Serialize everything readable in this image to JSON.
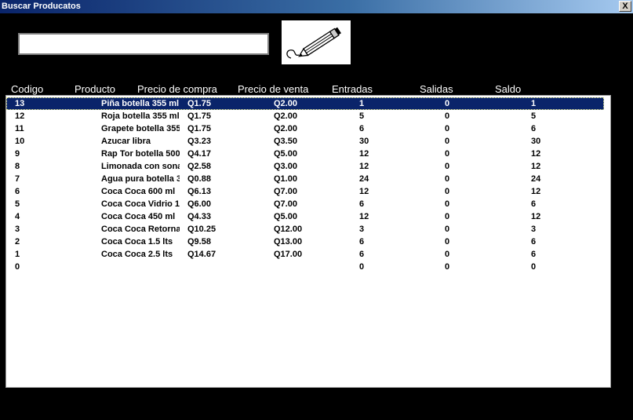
{
  "window": {
    "title": "Buscar Producatos",
    "close_label": "X"
  },
  "search": {
    "value": "",
    "placeholder": ""
  },
  "columns": [
    "Codigo",
    "Producto",
    "Precio de compra",
    "Precio de venta",
    "Entradas",
    "Salidas",
    "Saldo"
  ],
  "rows": [
    {
      "codigo": "13",
      "producto": "Piña botella 355 ml",
      "compra": "Q1.75",
      "venta": "Q2.00",
      "entradas": "1",
      "salidas": "0",
      "saldo": "1",
      "selected": true
    },
    {
      "codigo": "12",
      "producto": "Roja botella 355 ml",
      "compra": "Q1.75",
      "venta": "Q2.00",
      "entradas": "5",
      "salidas": "0",
      "saldo": "5"
    },
    {
      "codigo": "11",
      "producto": "Grapete botella 355",
      "compra": "Q1.75",
      "venta": "Q2.00",
      "entradas": "6",
      "salidas": "0",
      "saldo": "6"
    },
    {
      "codigo": "10",
      "producto": "Azucar libra",
      "compra": "Q3.23",
      "venta": "Q3.50",
      "entradas": "30",
      "salidas": "0",
      "saldo": "30"
    },
    {
      "codigo": "9",
      "producto": "Rap Tor botella 500",
      "compra": "Q4.17",
      "venta": "Q5.00",
      "entradas": "12",
      "salidas": "0",
      "saldo": "12"
    },
    {
      "codigo": "8",
      "producto": "Limonada con sona",
      "compra": "Q2.58",
      "venta": "Q3.00",
      "entradas": "12",
      "salidas": "0",
      "saldo": "12"
    },
    {
      "codigo": "7",
      "producto": "Agua pura botella 3",
      "compra": "Q0.88",
      "venta": "Q1.00",
      "entradas": "24",
      "salidas": "0",
      "saldo": "24"
    },
    {
      "codigo": "6",
      "producto": "Coca Coca 600 ml",
      "compra": "Q6.13",
      "venta": "Q7.00",
      "entradas": "12",
      "salidas": "0",
      "saldo": "12"
    },
    {
      "codigo": "5",
      "producto": "Coca Coca Vidrio 1",
      "compra": "Q6.00",
      "venta": "Q7.00",
      "entradas": "6",
      "salidas": "0",
      "saldo": "6"
    },
    {
      "codigo": "4",
      "producto": "Coca Coca 450 ml",
      "compra": "Q4.33",
      "venta": "Q5.00",
      "entradas": "12",
      "salidas": "0",
      "saldo": "12"
    },
    {
      "codigo": "3",
      "producto": "Coca Coca Retorna",
      "compra": "Q10.25",
      "venta": "Q12.00",
      "entradas": "3",
      "salidas": "0",
      "saldo": "3"
    },
    {
      "codigo": "2",
      "producto": "Coca Coca 1.5 lts",
      "compra": "Q9.58",
      "venta": "Q13.00",
      "entradas": "6",
      "salidas": "0",
      "saldo": "6"
    },
    {
      "codigo": "1",
      "producto": "Coca Coca 2.5 lts",
      "compra": "Q14.67",
      "venta": "Q17.00",
      "entradas": "6",
      "salidas": "0",
      "saldo": "6"
    },
    {
      "codigo": "0",
      "producto": "",
      "compra": "",
      "venta": "",
      "entradas": "0",
      "salidas": "0",
      "saldo": "0"
    }
  ],
  "icons": {
    "search_button": "pencil-icon"
  },
  "colors": {
    "selection": "#0a246a",
    "background": "#000000"
  }
}
